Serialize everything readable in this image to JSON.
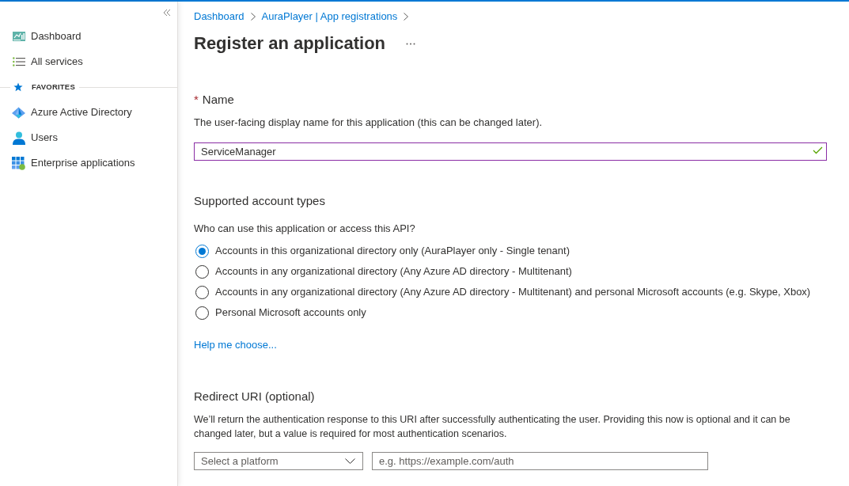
{
  "sidebar": {
    "items": [
      {
        "label": "Dashboard"
      },
      {
        "label": "All services"
      }
    ],
    "favorites": {
      "heading": "FAVORITES",
      "items": [
        {
          "label": "Azure Active Directory"
        },
        {
          "label": "Users"
        },
        {
          "label": "Enterprise applications"
        }
      ]
    }
  },
  "breadcrumb": [
    "Dashboard",
    "AuraPlayer | App registrations"
  ],
  "page_title": "Register an application",
  "name_field": {
    "required_mark": "*",
    "label": "Name",
    "description": "The user-facing display name for this application (this can be changed later).",
    "value": "ServiceManager",
    "focused": true,
    "valid": true
  },
  "account_types": {
    "heading": "Supported account types",
    "question": "Who can use this application or access this API?",
    "options": [
      {
        "label": "Accounts in this organizational directory only (AuraPlayer only - Single tenant)",
        "selected": true
      },
      {
        "label": "Accounts in any organizational directory (Any Azure AD directory - Multitenant)",
        "selected": false
      },
      {
        "label": "Accounts in any organizational directory (Any Azure AD directory - Multitenant) and personal Microsoft accounts (e.g. Skype, Xbox)",
        "selected": false
      },
      {
        "label": "Personal Microsoft accounts only",
        "selected": false
      }
    ],
    "help_link": "Help me choose..."
  },
  "redirect_uri": {
    "heading": "Redirect URI (optional)",
    "description": "We’ll return the authentication response to this URI after successfully authenticating the user. Providing this now is optional and it can be changed later, but a value is required for most authentication scenarios.",
    "platform_select": {
      "placeholder": "Select a platform"
    },
    "uri_field": {
      "placeholder": "e.g. https://example.com/auth"
    }
  }
}
